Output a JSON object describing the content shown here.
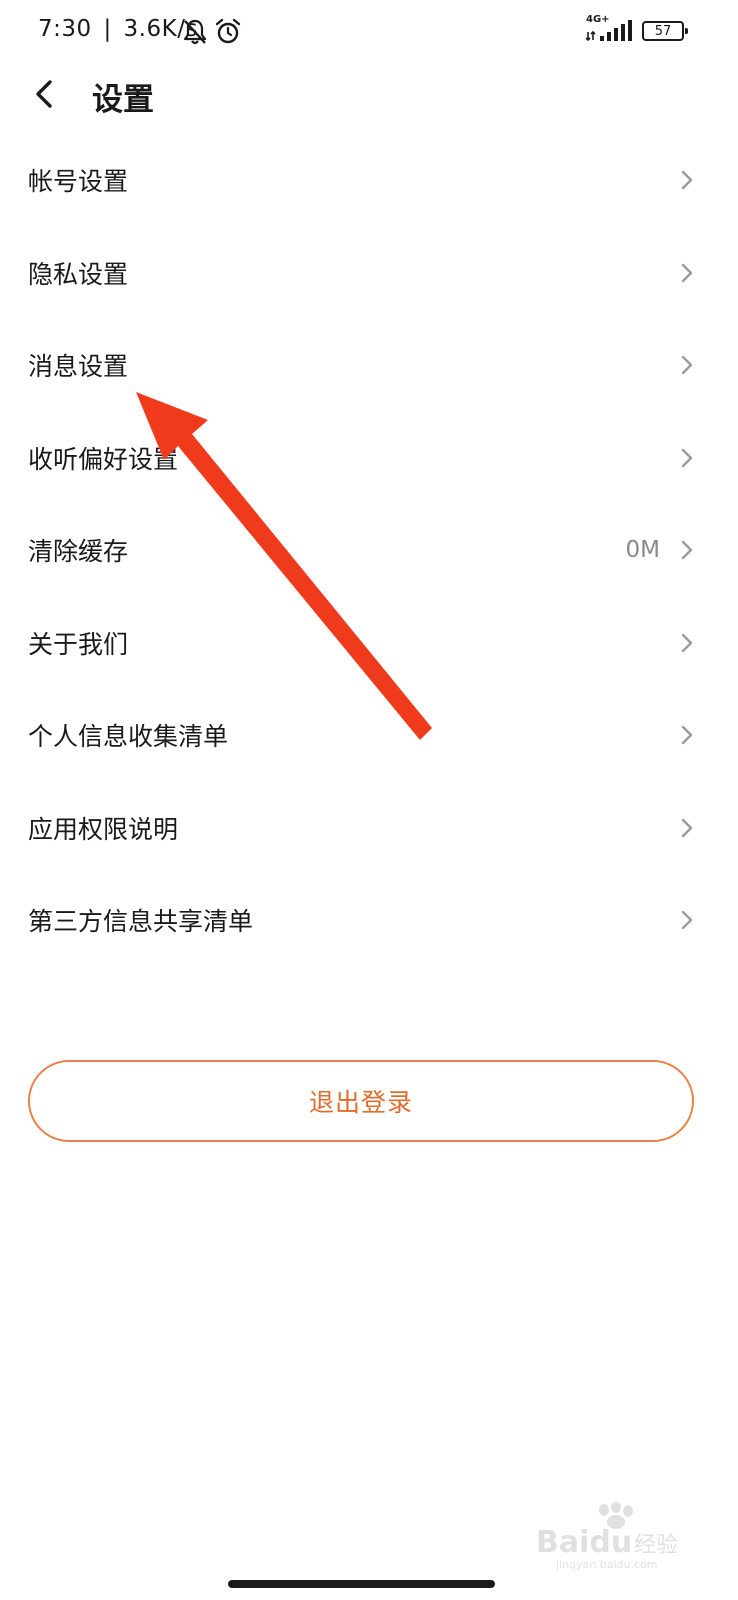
{
  "status_bar": {
    "time": "7:30",
    "separator": "|",
    "speed": "3.6K/s",
    "network_type": "4G+",
    "battery": "57",
    "icons": [
      "mute-notification-icon",
      "alarm-icon",
      "signal-icon",
      "battery-icon"
    ]
  },
  "header": {
    "title": "设置",
    "back_icon": "chevron-left-icon"
  },
  "settings": {
    "items": [
      {
        "label": "帐号设置",
        "value": ""
      },
      {
        "label": "隐私设置",
        "value": ""
      },
      {
        "label": "消息设置",
        "value": ""
      },
      {
        "label": "收听偏好设置",
        "value": ""
      },
      {
        "label": "清除缓存",
        "value": "0M"
      },
      {
        "label": "关于我们",
        "value": ""
      },
      {
        "label": "个人信息收集清单",
        "value": ""
      },
      {
        "label": "应用权限说明",
        "value": ""
      },
      {
        "label": "第三方信息共享清单",
        "value": ""
      }
    ]
  },
  "logout": {
    "label": "退出登录"
  },
  "colors": {
    "accent": "#e06c2c",
    "accent_border": "#e8824a",
    "annotation_arrow": "#f03a1c",
    "secondary_text": "#8a8a8a",
    "chevron": "#9a9a9a"
  },
  "watermark": {
    "brand": "Baidu",
    "label": "经验",
    "url": "jingyan.baidu.com"
  }
}
